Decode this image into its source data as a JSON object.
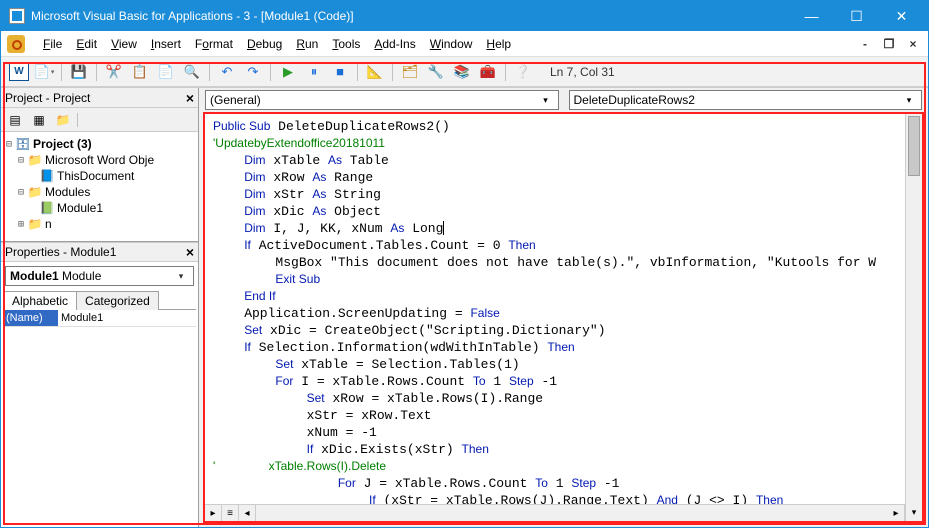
{
  "window": {
    "title": "Microsoft Visual Basic for Applications - 3 - [Module1 (Code)]"
  },
  "menu": {
    "file": "File",
    "edit": "Edit",
    "view": "View",
    "insert": "Insert",
    "format": "Format",
    "debug": "Debug",
    "run": "Run",
    "tools": "Tools",
    "addins": "Add-Ins",
    "window": "Window",
    "help": "Help"
  },
  "toolbar": {
    "status": "Ln 7, Col 31"
  },
  "project_panel": {
    "title": "Project - Project",
    "root": "Project (3)",
    "folder1": "Microsoft Word Obje",
    "doc": "ThisDocument",
    "folder2": "Modules",
    "mod": "Module1",
    "folder3_prefix": "n"
  },
  "props_panel": {
    "title": "Properties - Module1",
    "combo_bold": "Module1",
    "combo_rest": " Module",
    "tab1": "Alphabetic",
    "tab2": "Categorized",
    "prop_name": "(Name)",
    "prop_val": "Module1"
  },
  "code": {
    "combo_left": "(General)",
    "combo_right": "DeleteDuplicateRows2"
  }
}
